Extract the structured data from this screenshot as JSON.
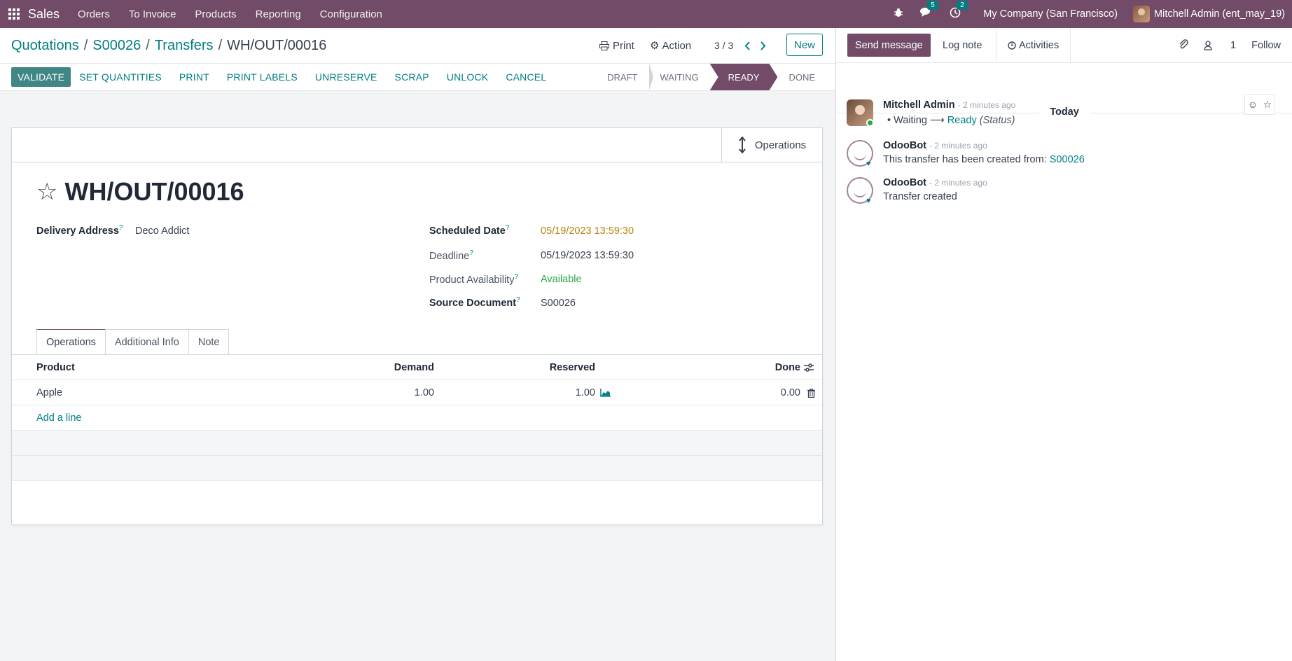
{
  "navbar": {
    "app_name": "Sales",
    "menus": [
      "Orders",
      "To Invoice",
      "Products",
      "Reporting",
      "Configuration"
    ],
    "messages_badge": "5",
    "activities_badge": "2",
    "company": "My Company (San Francisco)",
    "user": "Mitchell Admin (ent_may_19)"
  },
  "breadcrumb": {
    "items": [
      "Quotations",
      "S00026",
      "Transfers"
    ],
    "current": "WH/OUT/00016"
  },
  "control_panel": {
    "print_label": "Print",
    "action_label": "Action",
    "pager": "3 / 3",
    "new_label": "New"
  },
  "statusbar": {
    "buttons": [
      "VALIDATE",
      "SET QUANTITIES",
      "PRINT",
      "PRINT LABELS",
      "UNRESERVE",
      "SCRAP",
      "UNLOCK",
      "CANCEL"
    ],
    "stages": [
      "DRAFT",
      "WAITING",
      "READY",
      "DONE"
    ],
    "active_stage": "READY"
  },
  "form": {
    "smart_button": "Operations",
    "title": "WH/OUT/00016",
    "delivery_address_label": "Delivery Address",
    "delivery_address": "Deco Addict",
    "scheduled_date_label": "Scheduled Date",
    "scheduled_date": "05/19/2023 13:59:30",
    "deadline_label": "Deadline",
    "deadline": "05/19/2023 13:59:30",
    "availability_label": "Product Availability",
    "availability": "Available",
    "source_label": "Source Document",
    "source": "S00026",
    "help_mark": "?"
  },
  "tabs": [
    "Operations",
    "Additional Info",
    "Note"
  ],
  "operations": {
    "columns": {
      "product": "Product",
      "demand": "Demand",
      "reserved": "Reserved",
      "done": "Done"
    },
    "rows": [
      {
        "product": "Apple",
        "demand": "1.00",
        "reserved": "1.00",
        "done": "0.00"
      }
    ],
    "add_line": "Add a line"
  },
  "chatter": {
    "send_message": "Send message",
    "log_note": "Log note",
    "activities": "Activities",
    "followers_count": "1",
    "follow": "Follow",
    "date_separator": "Today",
    "messages": [
      {
        "author": "Mitchell Admin",
        "time": "- 2 minutes ago",
        "old": "Waiting",
        "arrow": "⟶",
        "new": "Ready",
        "field": "(Status)"
      },
      {
        "author": "OdooBot",
        "time": "- 2 minutes ago",
        "text": "This transfer has been created from:",
        "link": "S00026"
      },
      {
        "author": "OdooBot",
        "time": "- 2 minutes ago",
        "text": "Transfer created"
      }
    ]
  },
  "colors": {
    "brand": "#714b67",
    "accent": "#017e84",
    "validate": "#3f8684"
  }
}
